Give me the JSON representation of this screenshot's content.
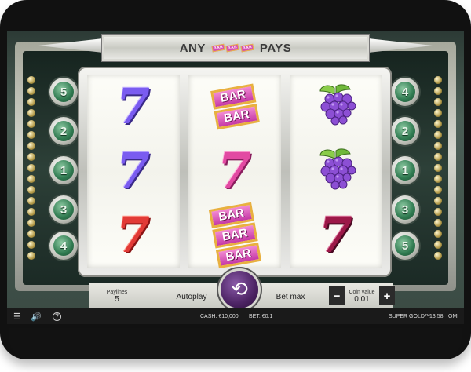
{
  "title": {
    "left": "ANY",
    "right": "PAYS",
    "mini_bar": "BAR"
  },
  "paylines_left": [
    "5",
    "2",
    "1",
    "3",
    "4"
  ],
  "paylines_right": [
    "4",
    "2",
    "1",
    "3",
    "5"
  ],
  "reels": [
    [
      {
        "type": "seven",
        "color": "purple",
        "text": "7"
      },
      {
        "type": "seven",
        "color": "purple",
        "text": "7"
      },
      {
        "type": "seven",
        "color": "red",
        "text": "7"
      }
    ],
    [
      {
        "type": "bar",
        "count": 2,
        "text": "BAR"
      },
      {
        "type": "seven",
        "color": "pink",
        "text": "7"
      },
      {
        "type": "bar",
        "count": 3,
        "text": "BAR"
      }
    ],
    [
      {
        "type": "grapes"
      },
      {
        "type": "grapes"
      },
      {
        "type": "seven",
        "color": "maroon",
        "text": "7"
      }
    ]
  ],
  "controls": {
    "paylines_label": "Paylines",
    "paylines_value": "5",
    "autoplay_label": "Autoplay",
    "betmax_label": "Bet max",
    "coin_value_label": "Coin value",
    "coin_value": "0.01",
    "minus": "−",
    "plus": "+"
  },
  "status": {
    "cash": "CASH: €10,000",
    "bet": "BET: €0.1",
    "game_name": "SUPER GOLD™",
    "time": "13:58",
    "brand": "OMI"
  },
  "icons": {
    "menu": "menu-icon",
    "sound": "sound-icon",
    "help": "help-icon",
    "spin": "spin-icon"
  }
}
